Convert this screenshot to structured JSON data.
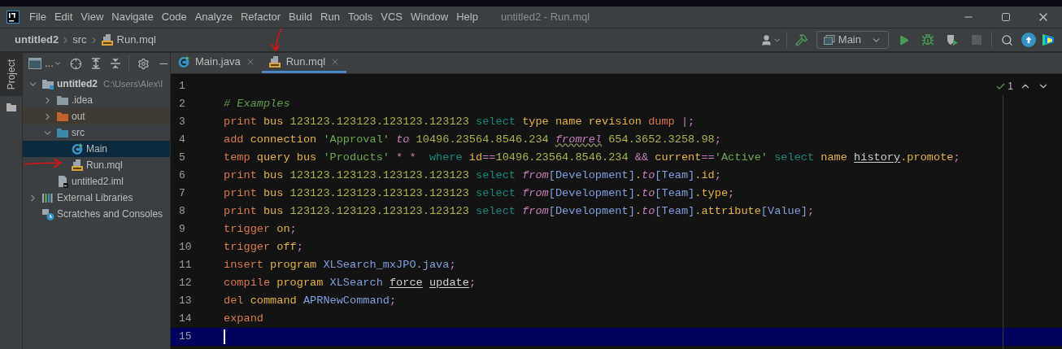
{
  "window": {
    "title": "untitled2 - Run.mql"
  },
  "menu": [
    {
      "label": "File"
    },
    {
      "label": "Edit"
    },
    {
      "label": "View"
    },
    {
      "label": "Navigate"
    },
    {
      "label": "Code"
    },
    {
      "label": "Analyze"
    },
    {
      "label": "Refactor"
    },
    {
      "label": "Build"
    },
    {
      "label": "Run"
    },
    {
      "label": "Tools"
    },
    {
      "label": "VCS"
    },
    {
      "label": "Window"
    },
    {
      "label": "Help"
    }
  ],
  "breadcrumbs": [
    {
      "label": "untitled2",
      "kind": "project"
    },
    {
      "label": "src",
      "kind": "folder"
    },
    {
      "label": "Run.mql",
      "kind": "mql"
    }
  ],
  "toolbar": {
    "run_config": "Main",
    "buttons": [
      {
        "kind": "run",
        "disabled": false
      },
      {
        "kind": "debug",
        "disabled": false
      },
      {
        "kind": "coverage",
        "disabled": false
      },
      {
        "kind": "stop",
        "disabled": true
      }
    ]
  },
  "tool_window_tab": {
    "label": "Project",
    "selected": true
  },
  "project_toolbar": {
    "view_label": "..."
  },
  "tree": [
    {
      "label": "untitled2",
      "detail": "C:\\Users\\Alex\\I",
      "kind": "project",
      "expanded": true,
      "selected": false,
      "children": [
        {
          "label": ".idea",
          "kind": "folder",
          "expanded": false,
          "selected": false
        },
        {
          "label": "out",
          "kind": "excluded",
          "expanded": false,
          "selected": false
        },
        {
          "label": "src",
          "kind": "source",
          "expanded": true,
          "selected": false,
          "children": [
            {
              "label": "Main",
              "kind": "java",
              "selected": true
            },
            {
              "label": "Run.mql",
              "kind": "mql",
              "selected": false
            }
          ]
        },
        {
          "label": "untitled2.iml",
          "kind": "iml",
          "selected": false
        }
      ]
    },
    {
      "label": "External Libraries",
      "kind": "libraries",
      "expanded": false,
      "selected": false
    },
    {
      "label": "Scratches and Consoles",
      "kind": "scratches",
      "selected": false
    }
  ],
  "tabs": [
    {
      "label": "Main.java",
      "kind": "java",
      "selected": false
    },
    {
      "label": "Run.mql",
      "kind": "mql",
      "selected": true
    }
  ],
  "inspections": {
    "count": "1"
  },
  "editor": {
    "lines": [
      {
        "number": "1",
        "current": false
      },
      {
        "number": "2",
        "current": false,
        "tokens": [
          {
            "text": "# Examples",
            "kind": "comment"
          }
        ]
      },
      {
        "number": "3",
        "current": false,
        "tokens": [
          {
            "text": "print",
            "kind": "verb"
          },
          {
            "text": " bus",
            "kind": "object"
          },
          {
            "text": " 123123.123123.123123.123123",
            "kind": "number"
          },
          {
            "text": " select",
            "kind": "clause"
          },
          {
            "text": " type name revision",
            "kind": "object"
          },
          {
            "text": " dump",
            "kind": "verb"
          },
          {
            "text": " |;",
            "kind": "op"
          }
        ]
      },
      {
        "number": "4",
        "current": false,
        "tokens": [
          {
            "text": "add",
            "kind": "verb"
          },
          {
            "text": " connection",
            "kind": "object"
          },
          {
            "text": " 'Approval' ",
            "kind": "string"
          },
          {
            "text": "to",
            "kind": "relation"
          },
          {
            "text": " 10496.23564.8546.234 ",
            "kind": "number"
          },
          {
            "text": "fromrel",
            "kind": "warning"
          },
          {
            "text": " 654.3652.3258.98",
            "kind": "number"
          },
          {
            "text": ";",
            "kind": "op"
          }
        ]
      },
      {
        "number": "5",
        "current": false,
        "tokens": [
          {
            "text": "temp",
            "kind": "verb"
          },
          {
            "text": " query bus",
            "kind": "object"
          },
          {
            "text": " 'Products'",
            "kind": "string"
          },
          {
            "text": " * *",
            "kind": "op"
          },
          {
            "text": "  where",
            "kind": "clause"
          },
          {
            "text": " id",
            "kind": "object"
          },
          {
            "text": "==",
            "kind": "op"
          },
          {
            "text": "10496.23564.8546.234",
            "kind": "number"
          },
          {
            "text": " &&",
            "kind": "op"
          },
          {
            "text": " current",
            "kind": "object"
          },
          {
            "text": "==",
            "kind": "op"
          },
          {
            "text": "'Active'",
            "kind": "string"
          },
          {
            "text": " select",
            "kind": "clause"
          },
          {
            "text": " name ",
            "kind": "object"
          },
          {
            "text": "history",
            "kind": "link"
          },
          {
            "text": ".promote",
            "kind": "object"
          },
          {
            "text": ";",
            "kind": "op"
          }
        ]
      },
      {
        "number": "6",
        "current": false,
        "tokens": [
          {
            "text": "print",
            "kind": "verb"
          },
          {
            "text": " bus",
            "kind": "object"
          },
          {
            "text": " 123123.123123.123123.123123",
            "kind": "number"
          },
          {
            "text": " select ",
            "kind": "clause"
          },
          {
            "text": "from",
            "kind": "relation"
          },
          {
            "text": "[Development]",
            "kind": "name"
          },
          {
            "text": ".",
            "kind": "object"
          },
          {
            "text": "to",
            "kind": "relation"
          },
          {
            "text": "[Team]",
            "kind": "name"
          },
          {
            "text": ".id",
            "kind": "object"
          },
          {
            "text": ";",
            "kind": "op"
          }
        ]
      },
      {
        "number": "7",
        "current": false,
        "tokens": [
          {
            "text": "print",
            "kind": "verb"
          },
          {
            "text": " bus",
            "kind": "object"
          },
          {
            "text": " 123123.123123.123123.123123",
            "kind": "number"
          },
          {
            "text": " select ",
            "kind": "clause"
          },
          {
            "text": "from",
            "kind": "relation"
          },
          {
            "text": "[Development]",
            "kind": "name"
          },
          {
            "text": ".",
            "kind": "object"
          },
          {
            "text": "to",
            "kind": "relation"
          },
          {
            "text": "[Team]",
            "kind": "name"
          },
          {
            "text": ".type",
            "kind": "object"
          },
          {
            "text": ";",
            "kind": "op"
          }
        ]
      },
      {
        "number": "8",
        "current": false,
        "tokens": [
          {
            "text": "print",
            "kind": "verb"
          },
          {
            "text": " bus",
            "kind": "object"
          },
          {
            "text": " 123123.123123.123123.123123",
            "kind": "number"
          },
          {
            "text": " select ",
            "kind": "clause"
          },
          {
            "text": "from",
            "kind": "relation"
          },
          {
            "text": "[Development]",
            "kind": "name"
          },
          {
            "text": ".",
            "kind": "object"
          },
          {
            "text": "to",
            "kind": "relation"
          },
          {
            "text": "[Team]",
            "kind": "name"
          },
          {
            "text": ".attribute",
            "kind": "object"
          },
          {
            "text": "[Value]",
            "kind": "name"
          },
          {
            "text": ";",
            "kind": "op"
          }
        ]
      },
      {
        "number": "9",
        "current": false,
        "tokens": [
          {
            "text": "trigger",
            "kind": "verb"
          },
          {
            "text": " on",
            "kind": "object"
          },
          {
            "text": ";",
            "kind": "op"
          }
        ]
      },
      {
        "number": "10",
        "current": false,
        "tokens": [
          {
            "text": "trigger",
            "kind": "verb"
          },
          {
            "text": " off",
            "kind": "object"
          },
          {
            "text": ";",
            "kind": "op"
          }
        ]
      },
      {
        "number": "11",
        "current": false,
        "tokens": [
          {
            "text": "insert",
            "kind": "verb"
          },
          {
            "text": " program",
            "kind": "object"
          },
          {
            "text": " XLSearch_mxJPO.java",
            "kind": "name"
          },
          {
            "text": ";",
            "kind": "op"
          }
        ]
      },
      {
        "number": "12",
        "current": false,
        "tokens": [
          {
            "text": "compile",
            "kind": "verb"
          },
          {
            "text": " program",
            "kind": "object"
          },
          {
            "text": " XLSearch ",
            "kind": "name"
          },
          {
            "text": "force",
            "kind": "link"
          },
          {
            "text": " update",
            "kind": "link"
          },
          {
            "text": ";",
            "kind": "op"
          }
        ]
      },
      {
        "number": "13",
        "current": false,
        "tokens": [
          {
            "text": "del",
            "kind": "verb"
          },
          {
            "text": " command",
            "kind": "object"
          },
          {
            "text": " APRNewCommand",
            "kind": "name"
          },
          {
            "text": ";",
            "kind": "op"
          }
        ]
      },
      {
        "number": "14",
        "current": false,
        "tokens": [
          {
            "text": "expand",
            "kind": "verb"
          }
        ]
      },
      {
        "number": "15",
        "current": true
      }
    ]
  }
}
